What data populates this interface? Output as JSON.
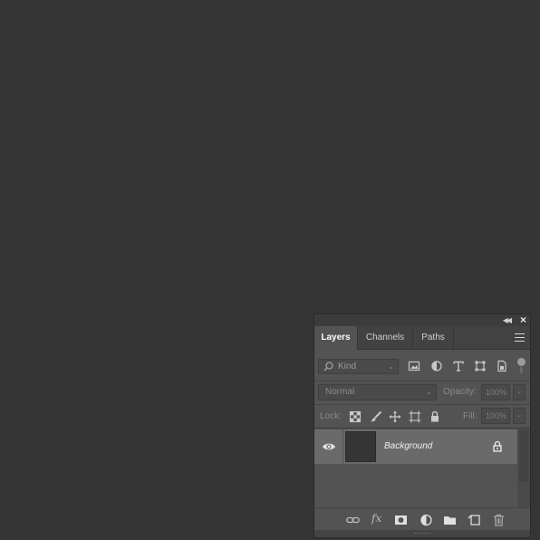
{
  "panel": {
    "tabs": [
      {
        "label": "Layers",
        "active": true
      },
      {
        "label": "Channels",
        "active": false
      },
      {
        "label": "Paths",
        "active": false
      }
    ],
    "filter": {
      "kind_label": "Kind"
    },
    "blend_mode": "Normal",
    "opacity_label": "Opacity:",
    "opacity_value": "100%",
    "lock_label": "Lock:",
    "fill_label": "Fill:",
    "fill_value": "100%",
    "layers": [
      {
        "name": "Background",
        "visible": true,
        "locked": true,
        "selected": true
      }
    ],
    "colors": {
      "canvas": "#353535",
      "panel_bg": "#535353",
      "selected_row": "#6a6a6a"
    }
  }
}
